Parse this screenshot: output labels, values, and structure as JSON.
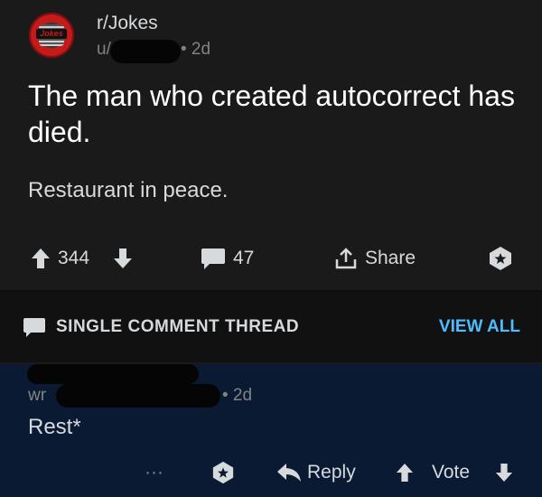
{
  "post": {
    "subreddit": "r/Jokes",
    "author_prefix": "u/",
    "time": "• 2d",
    "title": "The man who created autocorrect has died.",
    "body": "Restaurant in peace.",
    "avatar_logo_text": "Jokes",
    "actions": {
      "upvote_icon": "arrow-up-icon",
      "score": "344",
      "downvote_icon": "arrow-down-icon",
      "comment_icon": "comment-bubble-icon",
      "comments": "47",
      "share_icon": "share-icon",
      "share": "Share",
      "award_icon": "award-icon"
    }
  },
  "thread_bar": {
    "icon": "comment-bubble-icon",
    "label": "SINGLE COMMENT THREAD",
    "view_all": "VIEW ALL"
  },
  "comment": {
    "author_prefix": "wr",
    "time": "• 2d",
    "text": "Rest*",
    "actions": {
      "more": "···",
      "award_icon": "award-icon",
      "reply_icon": "reply-arrow-icon",
      "reply": "Reply",
      "upvote_icon": "arrow-up-icon",
      "vote": "Vote",
      "downvote_icon": "arrow-down-icon"
    }
  },
  "colors": {
    "background": "#1a1a1b",
    "comment_bg": "#0b1a33",
    "link": "#4fbcff",
    "muted": "#818384",
    "text": "#d7dadc"
  }
}
